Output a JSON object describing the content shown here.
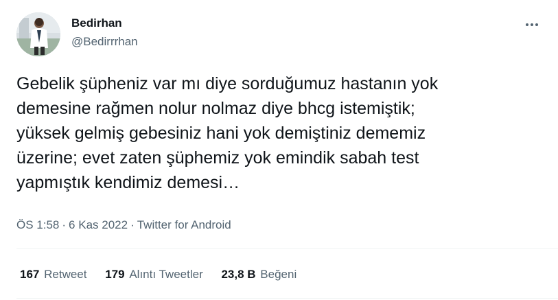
{
  "author": {
    "display_name": "Bedirhan",
    "handle": "@Bedirrrhan"
  },
  "more_icon": "more-horizontal-icon",
  "tweet": {
    "lines": [
      "Gebelik şüpheniz var mı diye sorduğumuz hastanın yok",
      "demesine rağmen nolur nolmaz diye bhcg istemiştik;",
      "yüksek gelmiş gebesiniz hani yok demiştiniz dememiz",
      "üzerine; evet zaten şüphemiz yok emindik sabah test",
      "yapmıştık kendimiz demesi…"
    ]
  },
  "meta": {
    "time": "ÖS 1:58",
    "separator": "·",
    "date": "6 Kas 2022",
    "source": "Twitter for Android"
  },
  "stats": {
    "retweets": {
      "count": "167",
      "label": "Retweet"
    },
    "quotes": {
      "count": "179",
      "label": "Alıntı Tweetler"
    },
    "likes": {
      "count": "23,8 B",
      "label": "Beğeni"
    }
  },
  "colors": {
    "text": "#0f1419",
    "secondary": "#536471",
    "divider": "#eff3f4"
  }
}
